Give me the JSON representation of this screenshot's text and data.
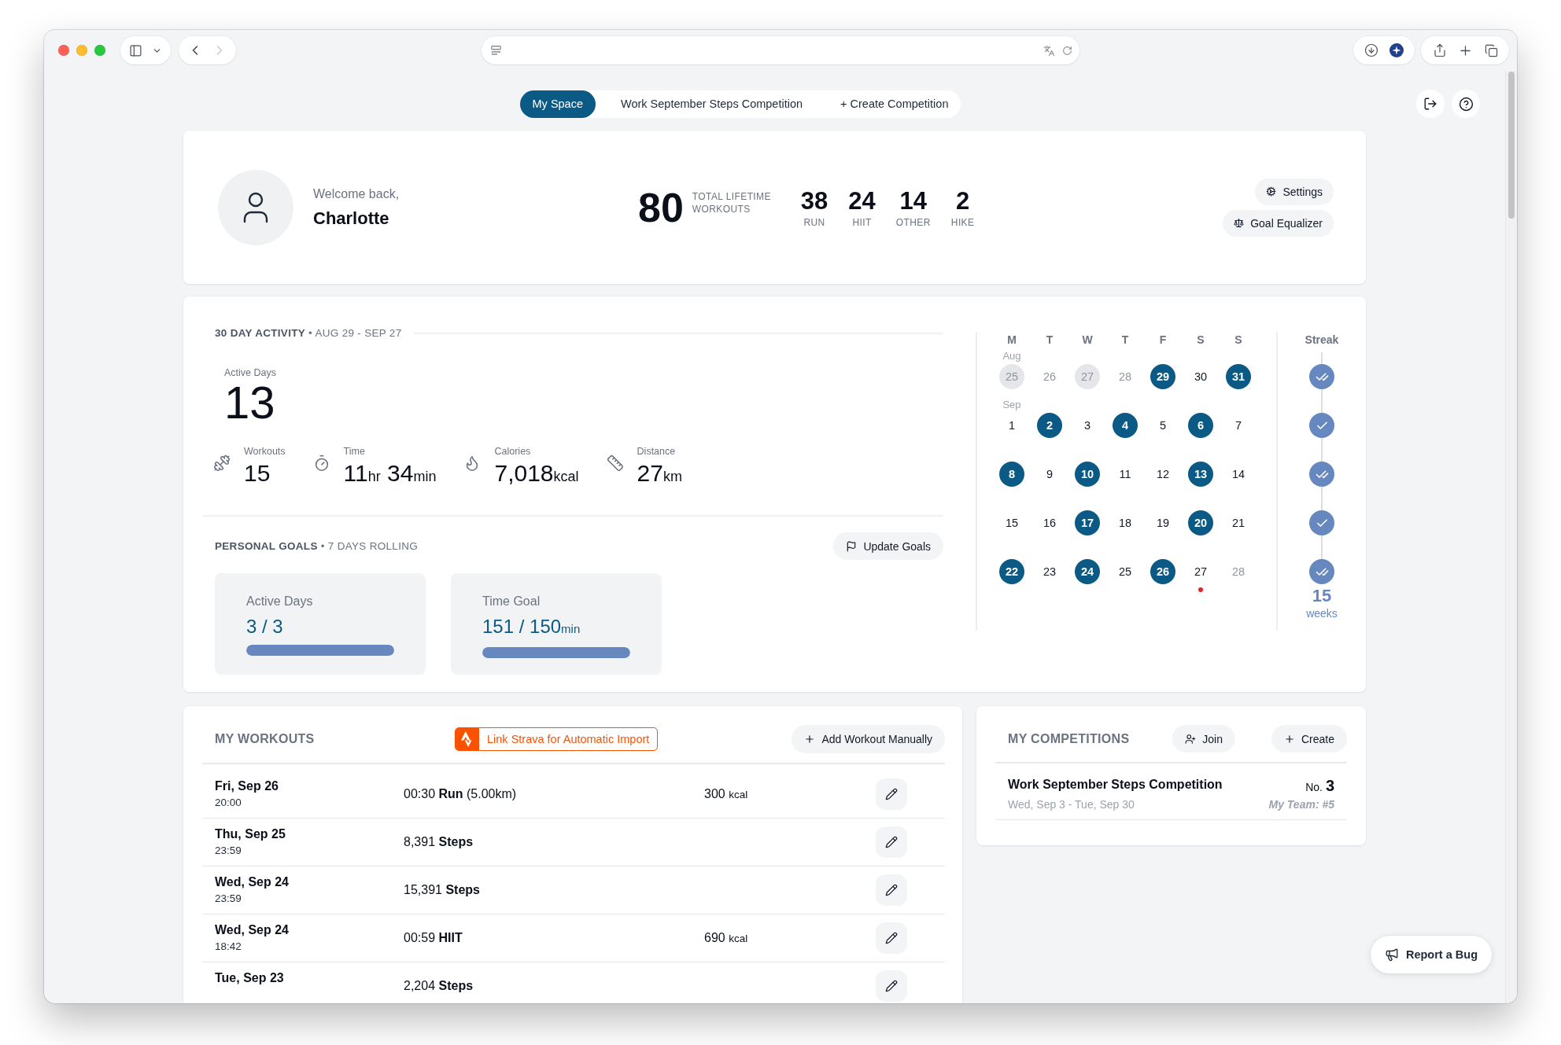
{
  "browser": {
    "nav_buttons": [
      {
        "kind": "back",
        "disabled": false
      },
      {
        "kind": "forward",
        "disabled": true
      }
    ]
  },
  "tabs": [
    {
      "label": "My Space",
      "selected": true
    },
    {
      "label": "Work September Steps Competition",
      "selected": false
    },
    {
      "label": "+ Create Competition",
      "selected": false
    }
  ],
  "profile": {
    "greeting": "Welcome back,",
    "name": "Charlotte"
  },
  "lifetime": {
    "total": "80",
    "total_label": "TOTAL LIFETIME WORKOUTS",
    "types": [
      {
        "count": "38",
        "label": "RUN"
      },
      {
        "count": "24",
        "label": "HIIT"
      },
      {
        "count": "14",
        "label": "OTHER"
      },
      {
        "count": "2",
        "label": "HIKE"
      }
    ]
  },
  "header_buttons": [
    {
      "kind": "settings",
      "label": "Settings"
    },
    {
      "kind": "equalizer",
      "label": "Goal Equalizer"
    }
  ],
  "activity": {
    "heading": "**30 DAY ACTIVITY** • AUG 29 - SEP 27",
    "active_days": {
      "label": "Active Days",
      "value": "13"
    },
    "stats": [
      {
        "kind": "workouts",
        "label": "Workouts",
        "parts": [
          {
            "number": "15"
          }
        ]
      },
      {
        "kind": "time",
        "label": "Time",
        "parts": [
          {
            "number": "11",
            "unit": "hr"
          },
          {
            "number": "34",
            "unit": "min"
          }
        ]
      },
      {
        "kind": "calories",
        "label": "Calories",
        "parts": [
          {
            "number": "7,018",
            "unit": "kcal"
          }
        ]
      },
      {
        "kind": "distance",
        "label": "Distance",
        "parts": [
          {
            "number": "27",
            "unit": "km"
          }
        ]
      }
    ]
  },
  "goals": {
    "heading": "**PERSONAL GOALS** • 7 DAYS ROLLING",
    "update_button": "Update Goals",
    "items": [
      {
        "label": "Active Days",
        "value": "3 / 3",
        "level": 1
      },
      {
        "label": "Time Goal",
        "value": "151 / 150",
        "unit": "min",
        "level": 1
      }
    ]
  },
  "calendar": {
    "weekdays": [
      "M",
      "T",
      "W",
      "T",
      "F",
      "S",
      "S"
    ],
    "weeks": [
      {
        "month": "Aug",
        "days": [
          {
            "day": "25",
            "active": true,
            "in_range": false,
            "today": false
          },
          {
            "day": "26",
            "active": false,
            "in_range": false,
            "today": false
          },
          {
            "day": "27",
            "active": true,
            "in_range": false,
            "today": false
          },
          {
            "day": "28",
            "active": false,
            "in_range": false,
            "today": false
          },
          {
            "day": "29",
            "active": true,
            "in_range": true,
            "today": false
          },
          {
            "day": "30",
            "active": false,
            "in_range": true,
            "today": false
          },
          {
            "day": "31",
            "active": true,
            "in_range": true,
            "today": false
          }
        ]
      },
      {
        "month": "Sep",
        "days": [
          {
            "day": "1",
            "active": false,
            "in_range": true,
            "today": false
          },
          {
            "day": "2",
            "active": true,
            "in_range": true,
            "today": false
          },
          {
            "day": "3",
            "active": false,
            "in_range": true,
            "today": false
          },
          {
            "day": "4",
            "active": true,
            "in_range": true,
            "today": false
          },
          {
            "day": "5",
            "active": false,
            "in_range": true,
            "today": false
          },
          {
            "day": "6",
            "active": true,
            "in_range": true,
            "today": false
          },
          {
            "day": "7",
            "active": false,
            "in_range": true,
            "today": false
          }
        ]
      },
      {
        "days": [
          {
            "day": "8",
            "active": true,
            "in_range": true,
            "today": false
          },
          {
            "day": "9",
            "active": false,
            "in_range": true,
            "today": false
          },
          {
            "day": "10",
            "active": true,
            "in_range": true,
            "today": false
          },
          {
            "day": "11",
            "active": false,
            "in_range": true,
            "today": false
          },
          {
            "day": "12",
            "active": false,
            "in_range": true,
            "today": false
          },
          {
            "day": "13",
            "active": true,
            "in_range": true,
            "today": false
          },
          {
            "day": "14",
            "active": false,
            "in_range": true,
            "today": false
          }
        ]
      },
      {
        "days": [
          {
            "day": "15",
            "active": false,
            "in_range": true,
            "today": false
          },
          {
            "day": "16",
            "active": false,
            "in_range": true,
            "today": false
          },
          {
            "day": "17",
            "active": true,
            "in_range": true,
            "today": false
          },
          {
            "day": "18",
            "active": false,
            "in_range": true,
            "today": false
          },
          {
            "day": "19",
            "active": false,
            "in_range": true,
            "today": false
          },
          {
            "day": "20",
            "active": true,
            "in_range": true,
            "today": false
          },
          {
            "day": "21",
            "active": false,
            "in_range": true,
            "today": false
          }
        ]
      },
      {
        "days": [
          {
            "day": "22",
            "active": true,
            "in_range": true,
            "today": false
          },
          {
            "day": "23",
            "active": false,
            "in_range": true,
            "today": false
          },
          {
            "day": "24",
            "active": true,
            "in_range": true,
            "today": false
          },
          {
            "day": "25",
            "active": false,
            "in_range": true,
            "today": false
          },
          {
            "day": "26",
            "active": true,
            "in_range": true,
            "today": false
          },
          {
            "day": "27",
            "active": false,
            "in_range": true,
            "today": true
          },
          {
            "day": "28",
            "active": false,
            "in_range": false,
            "today": false
          }
        ]
      }
    ]
  },
  "streak": {
    "title": "Streak",
    "weeks": [
      {
        "kind": "double"
      },
      {
        "kind": "single"
      },
      {
        "kind": "double"
      },
      {
        "kind": "single"
      },
      {
        "kind": "double"
      }
    ],
    "count": "15",
    "unit": "weeks"
  },
  "workouts": {
    "title": "MY WORKOUTS",
    "strava_button": "Link Strava for Automatic Import",
    "add_button": "Add Workout Manually",
    "rows": [
      {
        "date": "Fri, Sep 26",
        "time": "20:00",
        "activity": "00:30 **Run** (5.00km)",
        "calories": {
          "value": "300",
          "unit": "kcal"
        }
      },
      {
        "date": "Thu, Sep 25",
        "time": "23:59",
        "activity": "8,391 **Steps**"
      },
      {
        "date": "Wed, Sep 24",
        "time": "23:59",
        "activity": "15,391 **Steps**"
      },
      {
        "date": "Wed, Sep 24",
        "time": "18:42",
        "activity": "00:59 **HIIT**",
        "calories": {
          "value": "690",
          "unit": "kcal"
        }
      },
      {
        "date": "Tue, Sep 23",
        "activity": "2,204 **Steps**"
      }
    ]
  },
  "competitions": {
    "title": "MY COMPETITIONS",
    "join_button": "Join",
    "create_button": "Create",
    "items": [
      {
        "name": "Work September Steps Competition",
        "dates": "Wed, Sep 3 - Tue, Sep 30",
        "rank_label": "No.",
        "rank": "3",
        "team": "My Team: #5"
      }
    ]
  },
  "report_button": "Report a Bug"
}
